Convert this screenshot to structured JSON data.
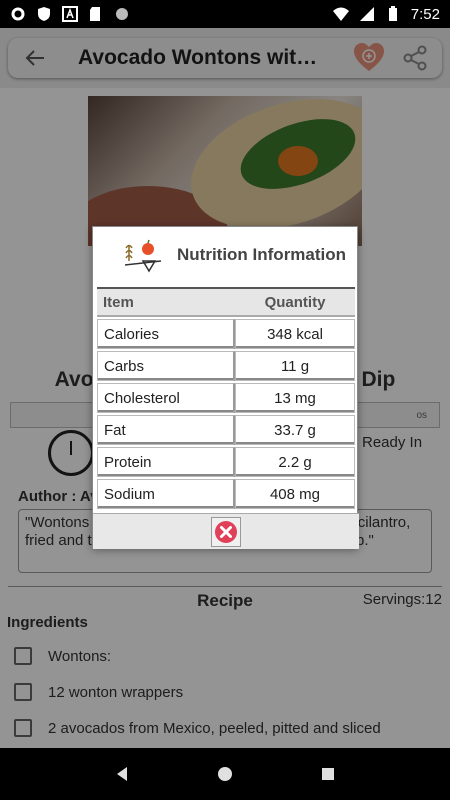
{
  "status_bar": {
    "time": "7:52",
    "left_icons": [
      "gear-icon",
      "shield-icon",
      "a-badge-icon",
      "sd-card-icon",
      "circle-icon"
    ],
    "right_icons": [
      "wifi-icon",
      "signal-icon",
      "battery-icon"
    ]
  },
  "app_bar": {
    "title": "Avocado Wontons wit…",
    "back_icon": "back-arrow-icon",
    "favorite_icon": "heart-add-icon",
    "share_icon": "share-icon",
    "accent_color": "#e8927c"
  },
  "recipe": {
    "title": "Avocado Wontons with Ranch Dip",
    "tags_left": "",
    "tags_right": "os",
    "ready_in_label": "Ready In",
    "author_label": "Author : Av",
    "description": "\"Wontons filled with avocado, red onion and fresh cilantro, fried and then served with a creamy ranch-style dip.\"",
    "section_title": "Recipe",
    "servings": "Servings:12",
    "ingredients_title": "Ingredients",
    "ingredients": [
      "Wontons:",
      "12 wonton wrappers",
      "2 avocados from Mexico, peeled, pitted and sliced"
    ]
  },
  "dialog": {
    "title": "Nutrition Information",
    "logo_text": "NUTRITION",
    "columns": [
      "Item",
      "Quantity"
    ],
    "rows": [
      {
        "item": "Calories",
        "quantity": "348 kcal"
      },
      {
        "item": "Carbs",
        "quantity": "11 g"
      },
      {
        "item": "Cholesterol",
        "quantity": "13 mg"
      },
      {
        "item": "Fat",
        "quantity": "33.7 g"
      },
      {
        "item": "Protein",
        "quantity": "2.2 g"
      },
      {
        "item": "Sodium",
        "quantity": "408 mg"
      }
    ],
    "close_icon": "close-x-icon",
    "close_color": "#e0405a"
  },
  "nav_bar": {
    "back_icon": "nav-back-icon",
    "home_icon": "nav-home-icon",
    "recents_icon": "nav-recents-icon"
  }
}
